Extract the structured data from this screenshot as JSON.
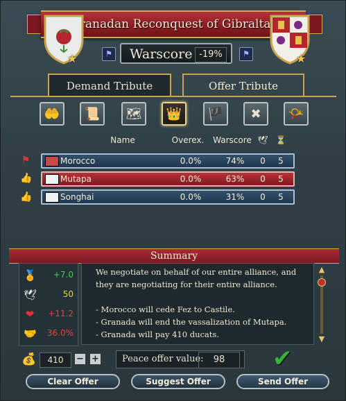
{
  "title": "Granadan Reconquest of Gibraltar",
  "warscore": {
    "label": "Warscore",
    "value": "-19%"
  },
  "tabs": {
    "demand": "Demand Tribute",
    "offer": "Offer Tribute"
  },
  "table": {
    "headers": {
      "name": "Name",
      "overextension": "Overex.",
      "warscore": "Warscore"
    },
    "rows": [
      {
        "name": "Morocco",
        "overex": "0.0%",
        "warscore": "74%",
        "peace": "0",
        "allies": "5",
        "selected": false
      },
      {
        "name": "Mutapa",
        "overex": "0.0%",
        "warscore": "63%",
        "peace": "0",
        "allies": "5",
        "selected": true
      },
      {
        "name": "Songhai",
        "overex": "0.0%",
        "warscore": "31%",
        "peace": "0",
        "allies": "5",
        "selected": false
      }
    ]
  },
  "summary": {
    "title": "Summary",
    "stats": [
      {
        "icon": "prestige-icon",
        "value": "+7.0",
        "color": "#3bd13f"
      },
      {
        "icon": "peace-dove-icon",
        "value": "50",
        "color": "#e8d04a"
      },
      {
        "icon": "hearts-icon",
        "value": "+11.2",
        "color": "#e04545"
      },
      {
        "icon": "handshake-icon",
        "value": "36.0%",
        "color": "#e04545"
      }
    ],
    "lines": [
      "We negotiate on behalf of our entire alliance, and they are negotiating for their entire alliance.",
      "",
      "- Morocco will cede Fez to Castile.",
      "- Granada will end the vassalization of Mutapa.",
      "- Granada will pay 410 ducats."
    ]
  },
  "controls": {
    "ducats": "410",
    "minus": "−",
    "plus": "+",
    "peace_offer_label": "Peace offer value:",
    "peace_offer_value": "98",
    "clear": "Clear Offer",
    "suggest": "Suggest Offer",
    "send": "Send Offer"
  }
}
